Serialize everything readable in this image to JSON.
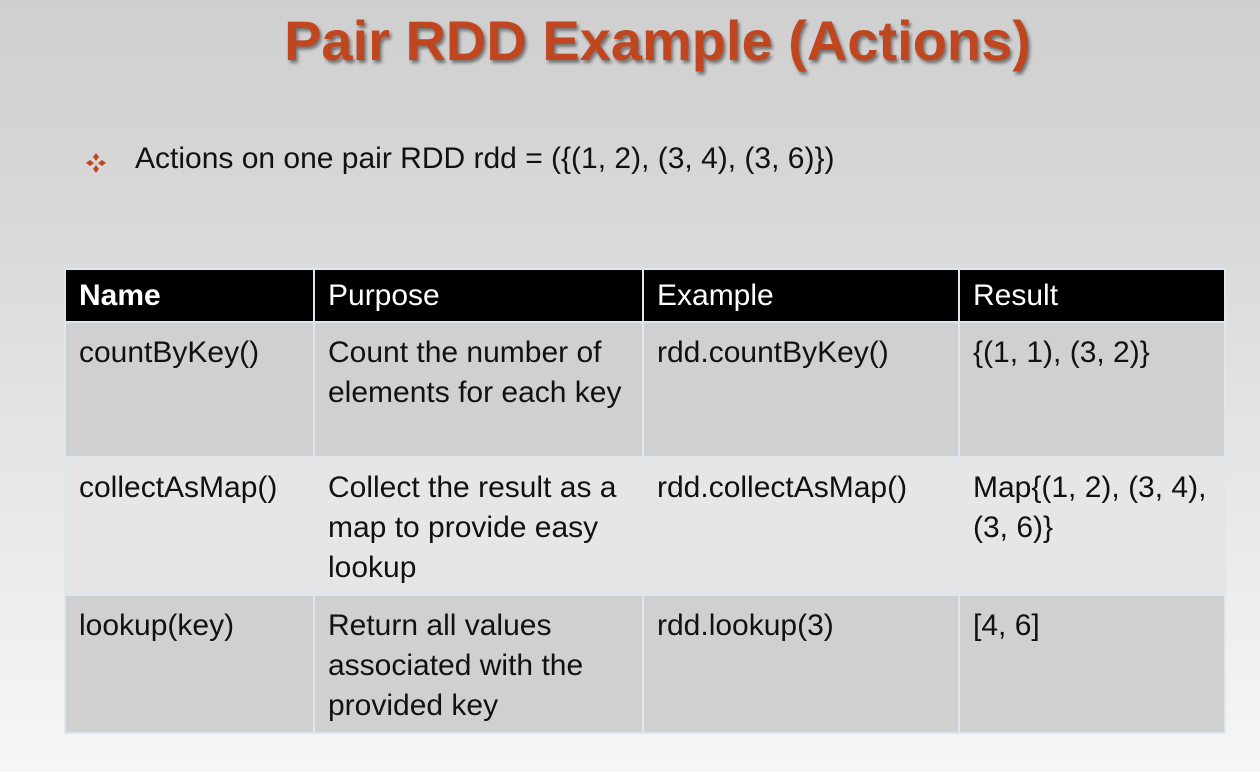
{
  "slide": {
    "title": "Pair RDD Example (Actions)",
    "bullet": "Actions on one pair RDD rdd = ({(1, 2), (3, 4), (3, 6)})",
    "bullet_icon": "diamond-bullet-icon",
    "colors": {
      "title": "#c0461f",
      "bullet_icon": "#c0461f",
      "header_bg": "#000000",
      "row_odd": "#d0d0d0",
      "row_even": "#e6e6e6"
    }
  },
  "table": {
    "headers": [
      "Name",
      "Purpose",
      "Example",
      "Result"
    ],
    "rows": [
      {
        "name": "countByKey()",
        "purpose": "Count the number of elements for each key",
        "example": "rdd.countByKey()",
        "result": "{(1, 1), (3, 2)}"
      },
      {
        "name": "collectAsMap()",
        "purpose": "Collect the result as a map to provide easy lookup",
        "example": "rdd.collectAsMap()",
        "result": "Map{(1, 2), (3, 4), (3, 6)}"
      },
      {
        "name": "lookup(key)",
        "purpose": "Return all values associated with the provided key",
        "example": "rdd.lookup(3)",
        "result": "[4, 6]"
      }
    ]
  }
}
